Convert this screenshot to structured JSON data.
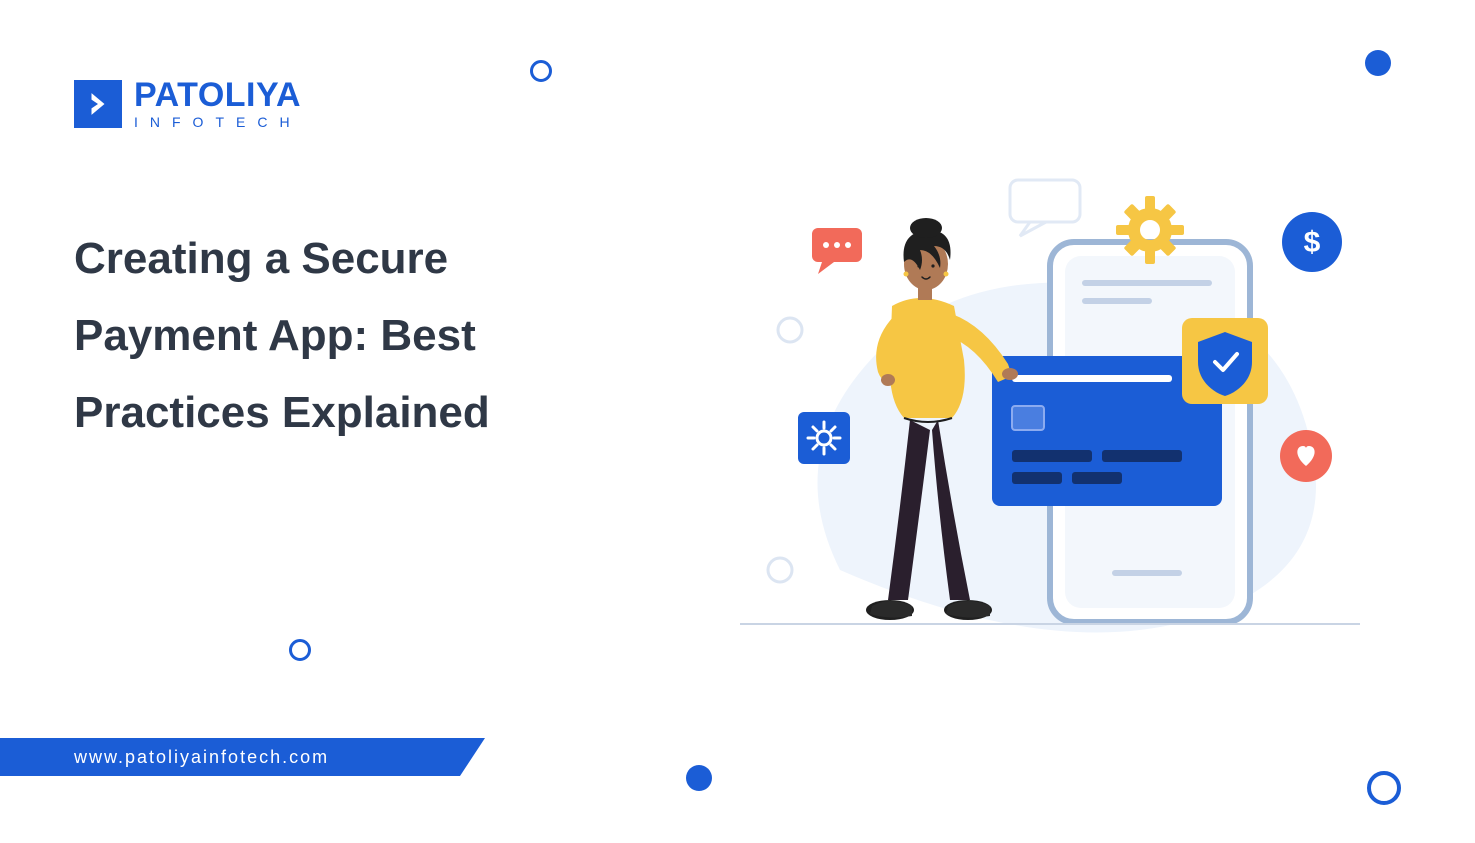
{
  "brand": {
    "name": "PATOLIYA",
    "subline": "INFOTECH"
  },
  "headline": "Creating a Secure Payment App: Best Practices Explained",
  "footer_url": "www.patoliyainfotech.com",
  "colors": {
    "accent": "#1b5dd6",
    "text": "#2f3846",
    "yellow": "#f6c644",
    "coral": "#f26a5a",
    "dark": "#1f1f1f",
    "skin": "#b07a56"
  },
  "icons": {
    "logo_chevron": "chevron-right-icon",
    "gear": "gear-icon",
    "dollar": "dollar-icon",
    "shield": "shield-icon",
    "heart": "heart-icon",
    "cog_small": "cog-icon",
    "chat": "chat-dots-icon"
  }
}
